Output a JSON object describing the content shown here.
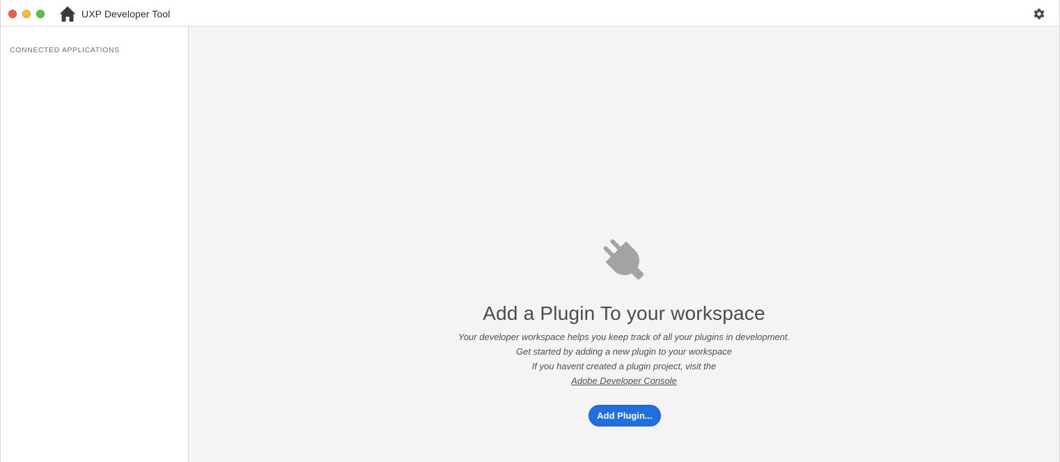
{
  "window": {
    "title": "UXP Developer Tool",
    "controls": [
      "close",
      "minimize",
      "maximize"
    ],
    "icons": {
      "home": "home-icon",
      "settings": "gear-icon"
    }
  },
  "sidebar": {
    "heading": "CONNECTED APPLICATIONS",
    "items": []
  },
  "main": {
    "empty_state": {
      "icon": "plug-icon",
      "title": "Add a Plugin To your workspace",
      "lines": [
        "Your developer workspace helps you keep track of all your plugins in development.",
        "Get started by adding a new plugin to your workspace",
        "If you havent created a plugin project, visit the"
      ],
      "link_label": "Adobe Developer Console",
      "button_label": "Add Plugin..."
    }
  },
  "colors": {
    "accent": "#1f6fe0",
    "main_background": "#f4f4f4",
    "icon_gray": "#a3a3a3"
  }
}
